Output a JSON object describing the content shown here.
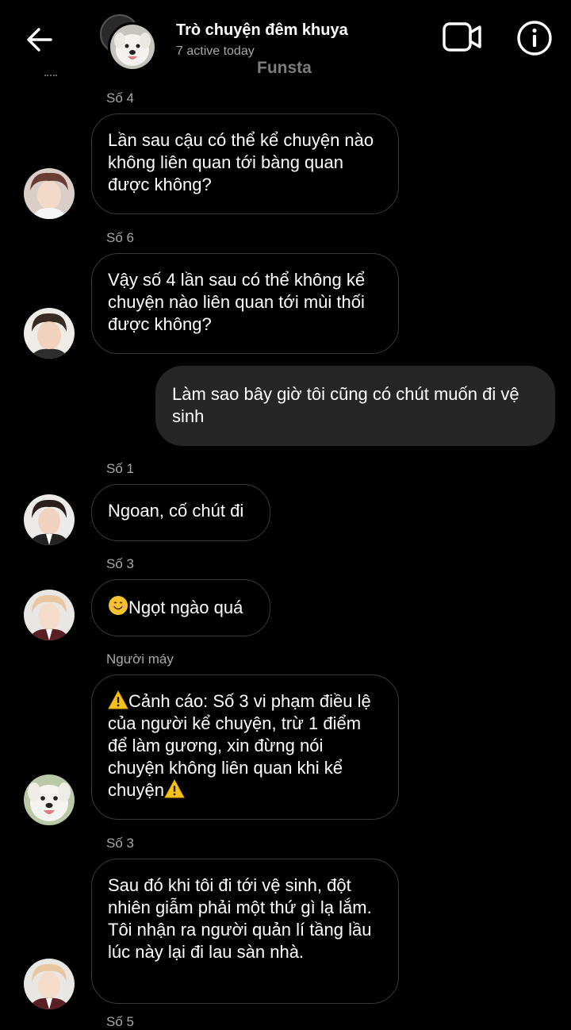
{
  "header": {
    "title": "Trò chuyện đêm khuya",
    "subtitle": "7 active today",
    "watermark": "Funsta"
  },
  "messages": [
    {
      "sender": "Số 4",
      "text": "Lần sau cậu có thể kể chuyện nào không liên quan tới bàng quan được không?"
    },
    {
      "sender": "Số 6",
      "text": "Vậy số 4 lần sau có thể không kể chuyện nào liên quan tới mùi thối được không?"
    },
    {
      "sender": "",
      "text": "Làm sao bây giờ tôi cũng có chút muốn đi vệ sinh",
      "outgoing": true
    },
    {
      "sender": "Số 1",
      "text": "Ngoan, cố chút đi"
    },
    {
      "sender": "Số 3",
      "text": "Ngọt ngào quá",
      "leading_emoji": "smiling-face-emoji"
    },
    {
      "sender": "Người máy",
      "text": "Cảnh cáo: Số 3 vi phạm điều lệ của người kể chuyện, trừ 1 điểm để làm gương, xin đừng nói chuyện không liên quan khi kể chuyện",
      "leading_emoji": "warning-emoji",
      "trailing_emoji": "warning-emoji"
    },
    {
      "sender": "Số 3",
      "text": "Sau đó khi tôi đi tới vệ sinh, đột nhiên giẫm phải một thứ gì lạ lắm. Tôi nhận ra người quản lí tầng lầu lúc này lại đi lau sàn nhà."
    }
  ],
  "partial_sender": "Số 5",
  "colors": {
    "background": "#000000",
    "outgoing_bubble": "#262626",
    "incoming_border": "#3a3a3a",
    "secondary_text": "#a8a8a8"
  }
}
